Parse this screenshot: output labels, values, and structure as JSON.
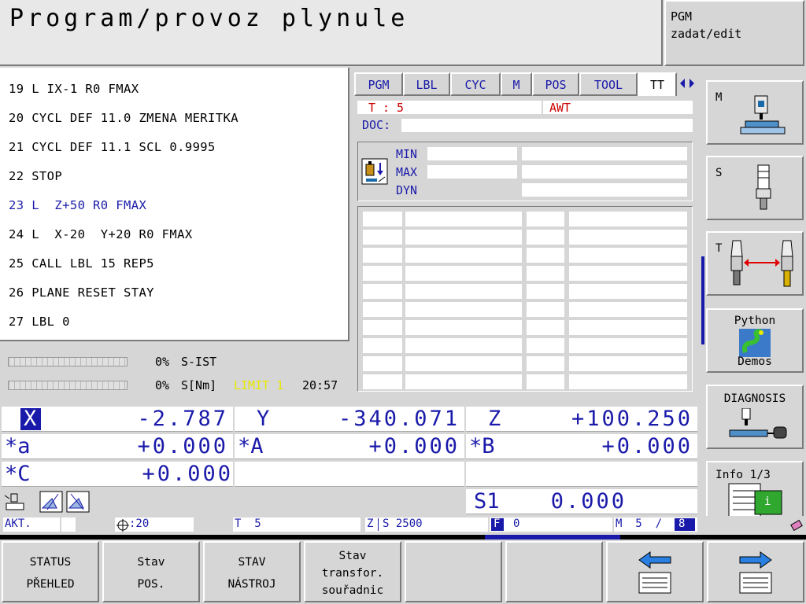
{
  "header": {
    "title": "Program/provoz plynule",
    "mode_line1": "PGM",
    "mode_line2": "zadat/edit"
  },
  "program": {
    "lines": [
      "19 L IX-1 R0 FMAX",
      "20 CYCL DEF 11.0 ZMENA MERITKA",
      "21 CYCL DEF 11.1 SCL 0.9995",
      "22 STOP",
      "23 L  Z+50 R0 FMAX",
      "24 L  X-20  Y+20 R0 FMAX",
      "25 CALL LBL 15 REP5",
      "26 PLANE RESET STAY",
      "27 LBL 0"
    ],
    "active_line": 4
  },
  "load": {
    "s_ist_pct": "0%",
    "s_ist_label": "S-IST",
    "s_nm_pct": "0%",
    "s_nm_label": "S[Nm]",
    "limit_label": "LIMIT 1",
    "time": "20:57"
  },
  "status_tabs": [
    "PGM",
    "LBL",
    "CYC",
    "M",
    "POS",
    "TOOL",
    "TT"
  ],
  "tt_panel": {
    "tool_label": "T :",
    "tool_value": "5",
    "awt_label": "AWT",
    "doc_label": "DOC:",
    "min_label": "MIN",
    "max_label": "MAX",
    "dyn_label": "DYN"
  },
  "right_softkeys": {
    "m_label": "M",
    "s_label": "S",
    "t_label": "T",
    "python_line1": "Python",
    "python_line2": "Demos",
    "diagnosis_label": "DIAGNOSIS",
    "info_label": "Info 1/3",
    "info_glyph": "i"
  },
  "positions": {
    "x_name": "X",
    "x_val": "-2.787",
    "y_name": "Y",
    "y_val": "-340.071",
    "z_name": "Z",
    "z_val": "+100.250",
    "a_name": "*a",
    "a_val": "+0.000",
    "A_name": "*A",
    "A_val": "+0.000",
    "B_name": "*B",
    "B_val": "+0.000",
    "C_name": "*C",
    "C_val": "+0.000",
    "s1_name": "S1",
    "s1_val": "0.000"
  },
  "info_bar": {
    "mode": "AKT.",
    "datum": ":20",
    "tool": "T  5",
    "z_label": "Z",
    "spindle": "S 2500",
    "feed_label": "F",
    "feed": "0",
    "m_func": "M  5  /",
    "m_func_active": "8"
  },
  "bottom_softkeys": [
    {
      "line1": "STATUS",
      "line2": "PŘEHLED"
    },
    {
      "line1": "Stav",
      "line2": "POS."
    },
    {
      "line1": "STAV",
      "line2": "NÁSTROJ"
    },
    {
      "line1": "Stav",
      "line2": "transfor.",
      "line3": "souřadnic"
    }
  ],
  "colors": {
    "axis_blue": "#1a1aaa",
    "active_red": "#cc0000",
    "limit_yellow": "#e8e800",
    "panel_gray": "#d6d6d6"
  }
}
